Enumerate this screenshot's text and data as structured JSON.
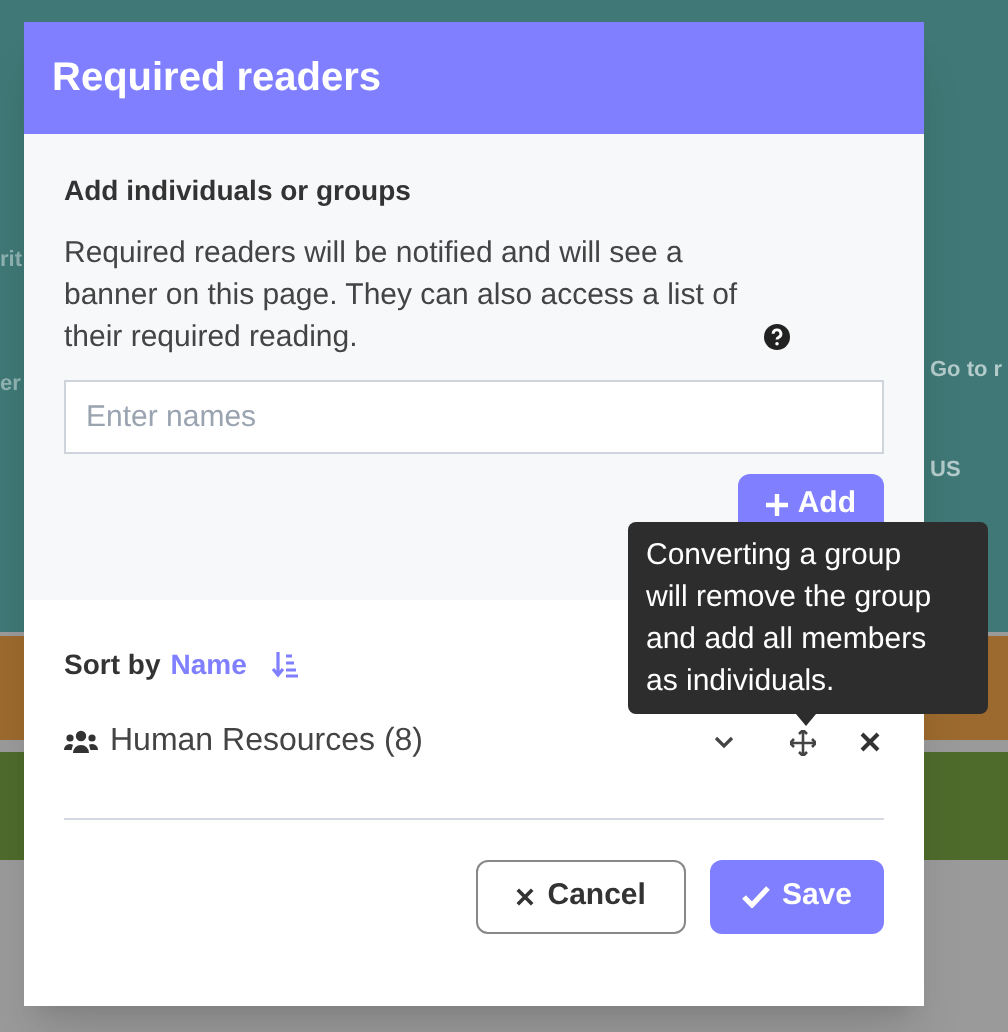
{
  "background": {
    "left_fragments": [
      "rit",
      "er"
    ],
    "right_fragments": [
      "Go to r",
      "US"
    ]
  },
  "modal": {
    "title": "Required readers",
    "section_heading": "Add individuals or groups",
    "description": "Required readers will be notified and will see a banner on this page. They can also access a list of their required reading.",
    "input": {
      "placeholder": "Enter names"
    },
    "add_button": "Add",
    "sort": {
      "label": "Sort by",
      "field": "Name"
    },
    "items": [
      {
        "name": "Human Resources (8)",
        "kind": "group"
      }
    ],
    "tooltip": "Converting a group will remove the group and add all members as individuals.",
    "buttons": [
      {
        "label": "Cancel",
        "kind": "secondary"
      },
      {
        "label": "Save",
        "kind": "primary"
      }
    ]
  }
}
